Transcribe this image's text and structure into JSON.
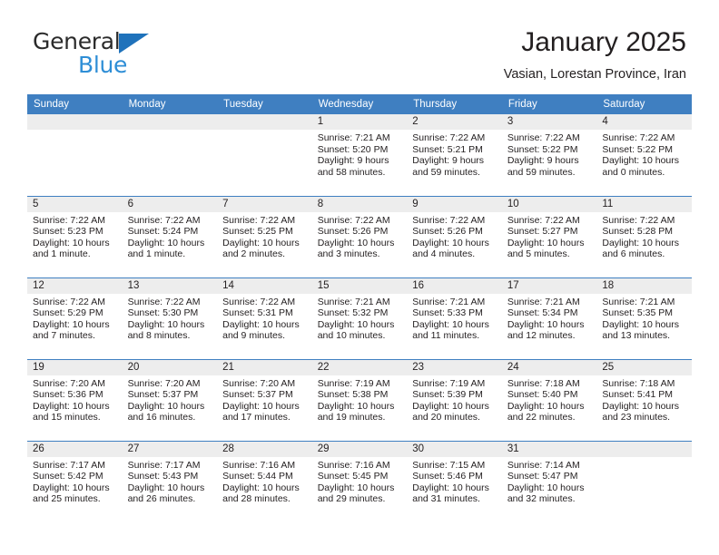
{
  "brand": {
    "name_top": "General",
    "name_bottom": "Blue",
    "accent_color": "#2e8ed6",
    "triangle_color": "#1f72bb"
  },
  "header": {
    "month_title": "January 2025",
    "location": "Vasian, Lorestan Province, Iran"
  },
  "calendar": {
    "header_color": "#3f7fc1",
    "daynum_band_color": "#ededed",
    "weekday_headers": [
      "Sunday",
      "Monday",
      "Tuesday",
      "Wednesday",
      "Thursday",
      "Friday",
      "Saturday"
    ],
    "weeks": [
      [
        {
          "day": "",
          "lines": []
        },
        {
          "day": "",
          "lines": []
        },
        {
          "day": "",
          "lines": []
        },
        {
          "day": "1",
          "lines": [
            "Sunrise: 7:21 AM",
            "Sunset: 5:20 PM",
            "Daylight: 9 hours",
            "and 58 minutes."
          ]
        },
        {
          "day": "2",
          "lines": [
            "Sunrise: 7:22 AM",
            "Sunset: 5:21 PM",
            "Daylight: 9 hours",
            "and 59 minutes."
          ]
        },
        {
          "day": "3",
          "lines": [
            "Sunrise: 7:22 AM",
            "Sunset: 5:22 PM",
            "Daylight: 9 hours",
            "and 59 minutes."
          ]
        },
        {
          "day": "4",
          "lines": [
            "Sunrise: 7:22 AM",
            "Sunset: 5:22 PM",
            "Daylight: 10 hours",
            "and 0 minutes."
          ]
        }
      ],
      [
        {
          "day": "5",
          "lines": [
            "Sunrise: 7:22 AM",
            "Sunset: 5:23 PM",
            "Daylight: 10 hours",
            "and 1 minute."
          ]
        },
        {
          "day": "6",
          "lines": [
            "Sunrise: 7:22 AM",
            "Sunset: 5:24 PM",
            "Daylight: 10 hours",
            "and 1 minute."
          ]
        },
        {
          "day": "7",
          "lines": [
            "Sunrise: 7:22 AM",
            "Sunset: 5:25 PM",
            "Daylight: 10 hours",
            "and 2 minutes."
          ]
        },
        {
          "day": "8",
          "lines": [
            "Sunrise: 7:22 AM",
            "Sunset: 5:26 PM",
            "Daylight: 10 hours",
            "and 3 minutes."
          ]
        },
        {
          "day": "9",
          "lines": [
            "Sunrise: 7:22 AM",
            "Sunset: 5:26 PM",
            "Daylight: 10 hours",
            "and 4 minutes."
          ]
        },
        {
          "day": "10",
          "lines": [
            "Sunrise: 7:22 AM",
            "Sunset: 5:27 PM",
            "Daylight: 10 hours",
            "and 5 minutes."
          ]
        },
        {
          "day": "11",
          "lines": [
            "Sunrise: 7:22 AM",
            "Sunset: 5:28 PM",
            "Daylight: 10 hours",
            "and 6 minutes."
          ]
        }
      ],
      [
        {
          "day": "12",
          "lines": [
            "Sunrise: 7:22 AM",
            "Sunset: 5:29 PM",
            "Daylight: 10 hours",
            "and 7 minutes."
          ]
        },
        {
          "day": "13",
          "lines": [
            "Sunrise: 7:22 AM",
            "Sunset: 5:30 PM",
            "Daylight: 10 hours",
            "and 8 minutes."
          ]
        },
        {
          "day": "14",
          "lines": [
            "Sunrise: 7:22 AM",
            "Sunset: 5:31 PM",
            "Daylight: 10 hours",
            "and 9 minutes."
          ]
        },
        {
          "day": "15",
          "lines": [
            "Sunrise: 7:21 AM",
            "Sunset: 5:32 PM",
            "Daylight: 10 hours",
            "and 10 minutes."
          ]
        },
        {
          "day": "16",
          "lines": [
            "Sunrise: 7:21 AM",
            "Sunset: 5:33 PM",
            "Daylight: 10 hours",
            "and 11 minutes."
          ]
        },
        {
          "day": "17",
          "lines": [
            "Sunrise: 7:21 AM",
            "Sunset: 5:34 PM",
            "Daylight: 10 hours",
            "and 12 minutes."
          ]
        },
        {
          "day": "18",
          "lines": [
            "Sunrise: 7:21 AM",
            "Sunset: 5:35 PM",
            "Daylight: 10 hours",
            "and 13 minutes."
          ]
        }
      ],
      [
        {
          "day": "19",
          "lines": [
            "Sunrise: 7:20 AM",
            "Sunset: 5:36 PM",
            "Daylight: 10 hours",
            "and 15 minutes."
          ]
        },
        {
          "day": "20",
          "lines": [
            "Sunrise: 7:20 AM",
            "Sunset: 5:37 PM",
            "Daylight: 10 hours",
            "and 16 minutes."
          ]
        },
        {
          "day": "21",
          "lines": [
            "Sunrise: 7:20 AM",
            "Sunset: 5:37 PM",
            "Daylight: 10 hours",
            "and 17 minutes."
          ]
        },
        {
          "day": "22",
          "lines": [
            "Sunrise: 7:19 AM",
            "Sunset: 5:38 PM",
            "Daylight: 10 hours",
            "and 19 minutes."
          ]
        },
        {
          "day": "23",
          "lines": [
            "Sunrise: 7:19 AM",
            "Sunset: 5:39 PM",
            "Daylight: 10 hours",
            "and 20 minutes."
          ]
        },
        {
          "day": "24",
          "lines": [
            "Sunrise: 7:18 AM",
            "Sunset: 5:40 PM",
            "Daylight: 10 hours",
            "and 22 minutes."
          ]
        },
        {
          "day": "25",
          "lines": [
            "Sunrise: 7:18 AM",
            "Sunset: 5:41 PM",
            "Daylight: 10 hours",
            "and 23 minutes."
          ]
        }
      ],
      [
        {
          "day": "26",
          "lines": [
            "Sunrise: 7:17 AM",
            "Sunset: 5:42 PM",
            "Daylight: 10 hours",
            "and 25 minutes."
          ]
        },
        {
          "day": "27",
          "lines": [
            "Sunrise: 7:17 AM",
            "Sunset: 5:43 PM",
            "Daylight: 10 hours",
            "and 26 minutes."
          ]
        },
        {
          "day": "28",
          "lines": [
            "Sunrise: 7:16 AM",
            "Sunset: 5:44 PM",
            "Daylight: 10 hours",
            "and 28 minutes."
          ]
        },
        {
          "day": "29",
          "lines": [
            "Sunrise: 7:16 AM",
            "Sunset: 5:45 PM",
            "Daylight: 10 hours",
            "and 29 minutes."
          ]
        },
        {
          "day": "30",
          "lines": [
            "Sunrise: 7:15 AM",
            "Sunset: 5:46 PM",
            "Daylight: 10 hours",
            "and 31 minutes."
          ]
        },
        {
          "day": "31",
          "lines": [
            "Sunrise: 7:14 AM",
            "Sunset: 5:47 PM",
            "Daylight: 10 hours",
            "and 32 minutes."
          ]
        },
        {
          "day": "",
          "lines": []
        }
      ]
    ]
  }
}
